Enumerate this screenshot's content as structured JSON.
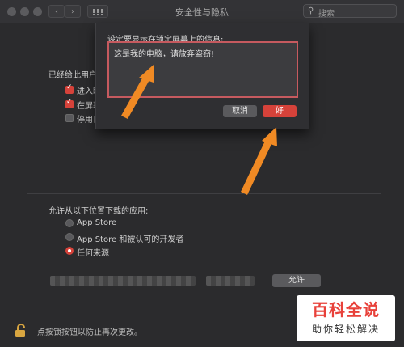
{
  "window": {
    "title": "安全性与隐私",
    "search_placeholder": "搜索"
  },
  "general": {
    "section_label": "已经给此用户",
    "options": [
      {
        "label": "进入睡",
        "checked": true
      },
      {
        "label": "在屏幕",
        "checked": true
      },
      {
        "label": "停用自",
        "checked": false
      }
    ]
  },
  "downloads": {
    "label": "允许从以下位置下载的应用:",
    "options": [
      {
        "label": "App Store",
        "selected": false
      },
      {
        "label": "App Store 和被认可的开发者",
        "selected": false
      },
      {
        "label": "任何来源",
        "selected": true
      }
    ],
    "allow_label": "允许"
  },
  "footer": {
    "hint": "点按锁按钮以防止再次更改。"
  },
  "sheet": {
    "label": "设定要显示在锁定屏幕上的信息:",
    "message": "这是我的电脑，请放弃盗窃!",
    "cancel_label": "取消",
    "ok_label": "好"
  },
  "watermark": {
    "top": "百科全说",
    "bottom": "助你轻松解决"
  },
  "colors": {
    "accent_red": "#d6423a",
    "arrow_orange": "#f08a24"
  }
}
